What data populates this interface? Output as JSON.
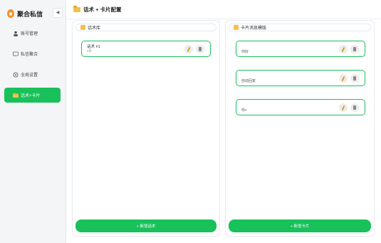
{
  "app": {
    "brand_name": "聚合私信",
    "collapse_label": "◀"
  },
  "sidebar": {
    "items": [
      {
        "label": "账号管理",
        "icon": "user-icon",
        "active": false
      },
      {
        "label": "私信聚合",
        "icon": "chat-icon",
        "active": false
      },
      {
        "label": "全局设置",
        "icon": "gear-icon",
        "active": false
      },
      {
        "label": "话术+卡片",
        "icon": "folder-icon",
        "active": true
      }
    ]
  },
  "header": {
    "title": "话术 + 卡片配置",
    "icon": "folder-icon"
  },
  "scripts_panel": {
    "title": "话术库",
    "items": [
      {
        "title": "话术 #1",
        "subtitle": "0条"
      }
    ],
    "add_label": "+ 新增话术"
  },
  "cards_panel": {
    "title": "卡片消息模版",
    "items": [
      {
        "text": "你好"
      },
      {
        "text": "自动回复"
      },
      {
        "text": "你+"
      }
    ],
    "add_label": "+ 新增卡片"
  },
  "colors": {
    "accent": "#18c15a",
    "sidebar_bg": "#f4f5f7",
    "folder": "#f5c04a"
  }
}
